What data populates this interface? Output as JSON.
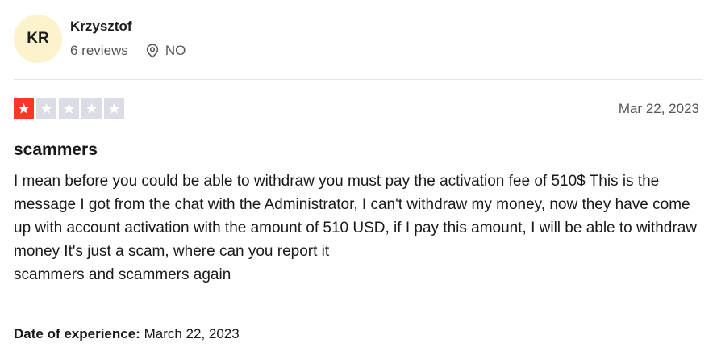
{
  "reviewer": {
    "initials": "KR",
    "name": "Krzysztof",
    "reviews_count": "6 reviews",
    "country": "NO"
  },
  "review": {
    "rating": 1,
    "max_rating": 5,
    "star_on_color": "#ff3722",
    "star_off_color": "#dcdce6",
    "date": "Mar 22, 2023",
    "title": "scammers",
    "paragraph1": "I mean before you could be able to withdraw you must pay the activation fee of 510$ This is the message I got from the chat with the Administrator, I can't withdraw my money, now they have come up with account activation with the amount of 510 USD, if I pay this amount, I will be able to withdraw money It's just a scam, where can you report it",
    "paragraph2": "scammers and scammers again",
    "experience_label": "Date of experience:",
    "experience_date": "March 22, 2023"
  },
  "icons": {
    "location": "location-pin-icon",
    "star": "star-icon"
  }
}
